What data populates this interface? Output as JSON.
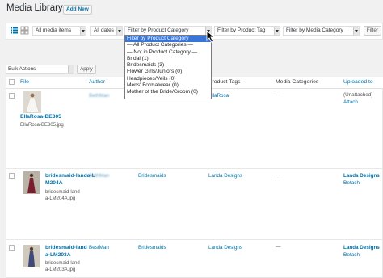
{
  "header": {
    "title": "Media Library",
    "add_new": "Add New"
  },
  "filters": {
    "media_type": "All media items",
    "dates": "All dates",
    "product_category": "Filter by Product Category",
    "product_tag": "Filter by Product Tag",
    "media_category": "Filter by Media Category",
    "filter_button": "Filter"
  },
  "dropdown": {
    "items": [
      "Filter by Product Category",
      "— All Product Categories —",
      "— Not in Product Category —",
      "Bridal  (1)",
      "Bridesmaids  (3)",
      "Flower Girls/Juniors  (0)",
      "Headpieces/Veils  (0)",
      "Mens' Formalwear  (0)",
      "Mother of the Bride/Groom  (0)"
    ]
  },
  "bulk": {
    "select": "Bulk Actions",
    "apply": "Apply"
  },
  "table": {
    "columns": [
      "File",
      "Author",
      "Product Tags",
      "Media Categories",
      "Uploaded to"
    ],
    "rows": [
      {
        "title": "EllaRosa-BE305",
        "filename": "EllaRosa-BE305.jpg",
        "author": "BethMan",
        "product_category": "",
        "product_tag": "EllaRosa",
        "media_category": "—",
        "uploaded": "(Unattached)",
        "action": "Attach"
      },
      {
        "title": "bridesmaid-landa-LM204A",
        "filename": "bridesmaid-landa-LM204A.jpg",
        "author": "BethMan",
        "product_category": "Bridesmaids",
        "product_tag": "Landa Designs",
        "media_category": "—",
        "uploaded": "Landa Designs –",
        "action": "Detach"
      },
      {
        "title": "bridesmaid-landa-LM203A",
        "filename": "bridesmaid-landa-LM203A.jpg",
        "author": "BestMan",
        "product_category": "Bridesmaids",
        "product_tag": "Landa Designs",
        "media_category": "—",
        "uploaded": "Landa Designs –",
        "action": "Detach"
      }
    ]
  }
}
